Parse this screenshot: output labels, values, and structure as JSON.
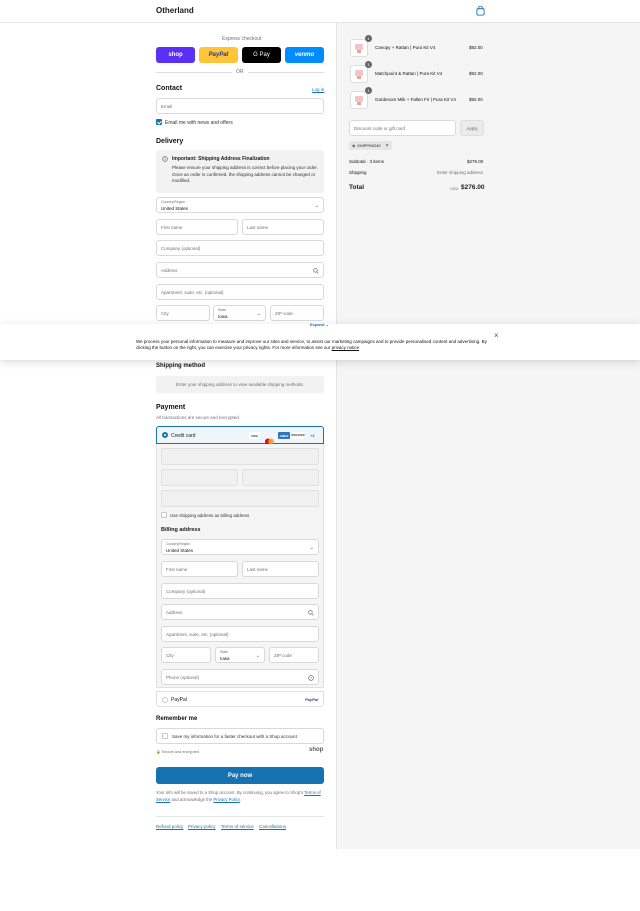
{
  "brand": "Otherland",
  "express": {
    "label": "Express checkout",
    "shop": "shop",
    "paypal": "PayPal",
    "gpay": "G Pay",
    "venmo": "venmo",
    "or": "OR"
  },
  "contact": {
    "title": "Contact",
    "login": "Log in",
    "email_placeholder": "Email",
    "news_label": "Email me with news and offers"
  },
  "delivery": {
    "title": "Delivery",
    "notice_title": "Important: Shipping Address Finalization",
    "notice_body": "Please ensure your shipping address is correct before placing your order. Once an order is confirmed, the shipping address cannot be changed or modified.",
    "country_label": "Country/Region",
    "country_value": "United States",
    "first": "First name",
    "last": "Last name",
    "company": "Company (optional)",
    "address": "Address",
    "apartment": "Apartment, suite, etc. (optional)",
    "city": "City",
    "state_label": "State",
    "state_value": "Iowa",
    "zip": "ZIP code"
  },
  "cookie": {
    "expand": "Expand",
    "text": "We process your personal information to measure and improve our sites and service, to assist our marketing campaigns and to provide personalised content and advertising. By clicking the button on the right, you can exercise your privacy rights. For more information see our",
    "link": "privacy notice"
  },
  "shipping_method": {
    "title": "Shipping method",
    "placeholder": "Enter your shipping address to view available shipping methods."
  },
  "payment": {
    "title": "Payment",
    "subtitle": "All transactions are secure and encrypted.",
    "credit_card": "Credit card",
    "visa": "VISA",
    "amex": "AMEX",
    "discover": "DISCOVER",
    "more": "+4",
    "use_shipping": "Use shipping address as billing address",
    "paypal": "PayPal",
    "paypal_logo": "PayPal"
  },
  "billing": {
    "title": "Billing address",
    "country_label": "Country/Region",
    "country_value": "United States",
    "first": "First name",
    "last": "Last name",
    "company": "Company (optional)",
    "address": "Address",
    "apartment": "Apartment, suite, etc. (optional)",
    "city": "City",
    "state_label": "State",
    "state_value": "Iowa",
    "zip": "ZIP code",
    "phone": "Phone (optional)"
  },
  "remember": {
    "title": "Remember me",
    "label": "Save my information for a faster checkout with a Shop account",
    "secure": "Secure and encrypted",
    "shop": "shop"
  },
  "pay_now": "Pay now",
  "legal": {
    "text1": "Your info will be saved to a Shop account. By continuing, you agree to Shop's",
    "terms": "Terms of Service",
    "text2": "and acknowledge the",
    "privacy": "Privacy Policy",
    "end": "."
  },
  "footer": {
    "refund": "Refund policy",
    "privacy": "Privacy policy",
    "terms": "Terms of service",
    "cancel": "Cancellations"
  },
  "cart": {
    "items": [
      {
        "name": "Canopy + Rattan | Pura Kit V4",
        "qty": "1",
        "price": "$92.00"
      },
      {
        "name": "Matchpoint & Rattan | Pura Kit V4",
        "qty": "1",
        "price": "$92.00"
      },
      {
        "name": "Gardenom Milk + Fallen Fir | Pura Kit V4",
        "qty": "1",
        "price": "$92.00"
      }
    ],
    "discount_placeholder": "Discount code or gift card",
    "apply": "Apply",
    "tag": "SHIPPING40",
    "subtotal_label": "Subtotal · 3 items",
    "subtotal": "$276.00",
    "shipping_label": "Shipping",
    "shipping": "Enter shipping address",
    "total_label": "Total",
    "currency": "USD",
    "total": "$276.00"
  },
  "colors": {
    "accent": "#1773b0",
    "shop": "#5a31f4",
    "paypal": "#ffc439",
    "venmo": "#008cff"
  }
}
